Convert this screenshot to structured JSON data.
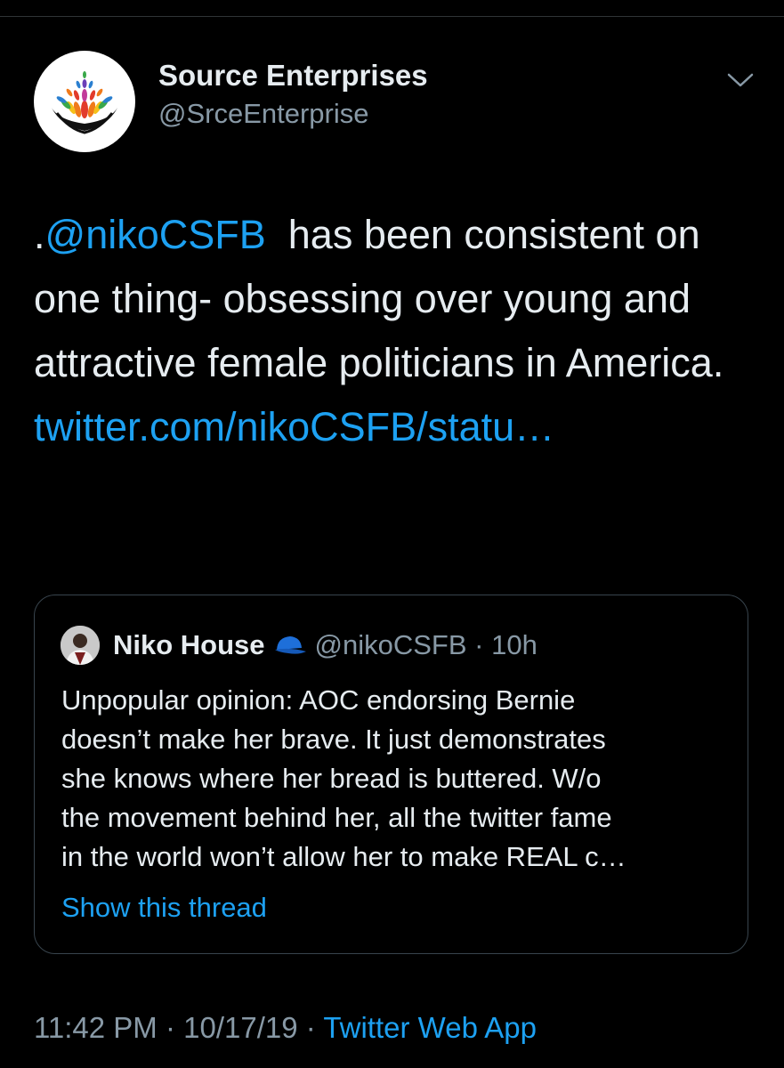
{
  "tweet": {
    "author_name": "Source Enterprises",
    "author_handle": "@SrceEnterprise",
    "avatar_icon": "lotus-hands-logo-icon",
    "menu_icon": "chevron-down-icon",
    "text_prefix": ".",
    "mention": "@nikoCSFB",
    "text_body": "  has been consistent on one thing- obsessing over young and attractive female politicians in America. ",
    "link_text": "twitter.com/nikoCSFB/statu…",
    "timestamp": "11:42 PM · 10/17/19 · ",
    "source_app": "Twitter Web App"
  },
  "quoted": {
    "name": "Niko House",
    "badge_icon": "blue-cap-icon",
    "handle_time": "@nikoCSFB · 10h",
    "lines": [
      "Unpopular opinion: AOC endorsing Bernie",
      "doesn’t make her brave. It just demonstrates",
      "she knows where her bread is buttered. W/o",
      "the movement behind her, all the twitter fame",
      "in the world won’t allow her to make REAL c…"
    ],
    "show_thread": "Show this thread"
  },
  "colors": {
    "background": "#000000",
    "text": "#e6ecf0",
    "secondary": "#8899a6",
    "link": "#1da1f2",
    "border": "#38444d"
  }
}
